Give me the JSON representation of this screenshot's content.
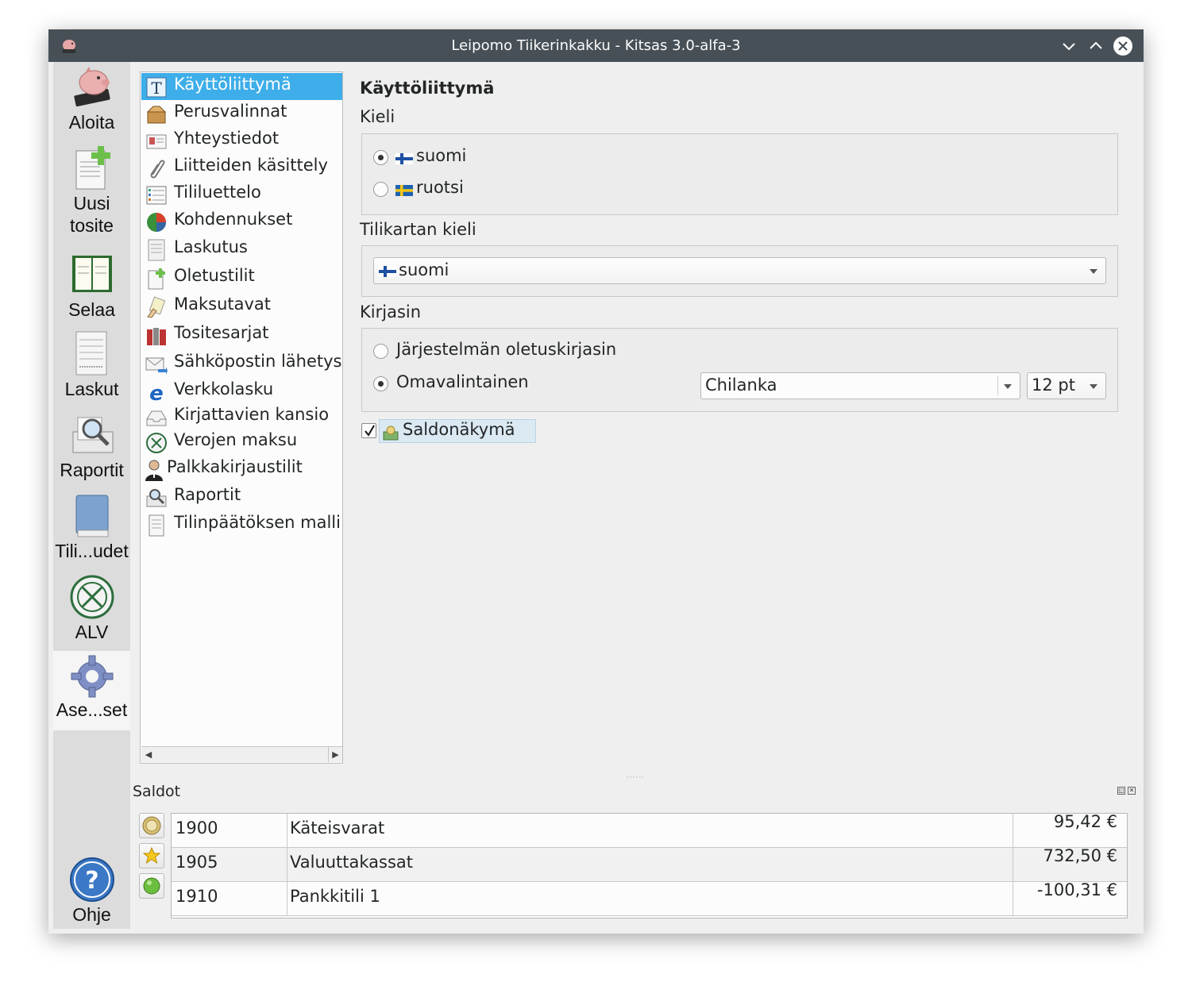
{
  "window": {
    "title": "Leipomo Tiikerinkakku - Kitsas 3.0-alfa-3"
  },
  "leftbar": {
    "items": [
      {
        "label": "Aloita",
        "icon": "piggy-bank-icon"
      },
      {
        "label": "Uusi\ntosite",
        "icon": "new-document-icon"
      },
      {
        "label": "Selaa",
        "icon": "journal-book-icon"
      },
      {
        "label": "Laskut",
        "icon": "invoice-icon"
      },
      {
        "label": "Raportit",
        "icon": "report-magnifier-icon"
      },
      {
        "label": "Tili...udet",
        "icon": "blue-book-icon"
      },
      {
        "label": "ALV",
        "icon": "tax-seal-icon"
      },
      {
        "label": "Ase...set",
        "icon": "gear-icon"
      },
      {
        "label": "Ohje",
        "icon": "help-icon"
      }
    ]
  },
  "nav": {
    "items": [
      {
        "label": "Käyttöliittymä",
        "icon": "text-t-icon",
        "selected": true
      },
      {
        "label": "Perusvalinnat",
        "icon": "open-box-icon"
      },
      {
        "label": "Yhteystiedot",
        "icon": "contact-card-icon"
      },
      {
        "label": "Liitteiden käsittely",
        "icon": "paperclip-icon"
      },
      {
        "label": "Tililuettelo",
        "icon": "account-list-icon"
      },
      {
        "label": "Kohdennukset",
        "icon": "pie-chart-icon"
      },
      {
        "label": "Laskutus",
        "icon": "invoice-icon"
      },
      {
        "label": "Oletustilit",
        "icon": "add-document-icon"
      },
      {
        "label": "Maksutavat",
        "icon": "payment-card-icon"
      },
      {
        "label": "Tositesarjat",
        "icon": "binders-icon"
      },
      {
        "label": "Sähköpostin lähetys",
        "icon": "email-send-icon"
      },
      {
        "label": "Verkkolasku",
        "icon": "e-invoice-icon"
      },
      {
        "label": "Kirjattavien kansio",
        "icon": "inbox-tray-icon"
      },
      {
        "label": "Verojen maksu",
        "icon": "tax-seal-icon"
      },
      {
        "label": "Palkkakirjaustilit",
        "icon": "person-icon"
      },
      {
        "label": "Raportit",
        "icon": "report-magnifier-icon"
      },
      {
        "label": "Tilinpäätöksen malli",
        "icon": "document-icon"
      }
    ]
  },
  "page": {
    "title": "Käyttöliittymä",
    "language": {
      "label": "Kieli",
      "options": [
        {
          "label": "suomi",
          "checked": true,
          "flag": "finland-flag-icon"
        },
        {
          "label": "ruotsi",
          "checked": false,
          "flag": "sweden-flag-icon"
        }
      ]
    },
    "chart_language": {
      "label": "Tilikartan kieli",
      "value": "suomi",
      "flag": "finland-flag-icon"
    },
    "font": {
      "label": "Kirjasin",
      "system_option": "Järjestelmän oletuskirjasin",
      "custom_option": "Omavalintainen",
      "custom_checked": true,
      "family": "Chilanka",
      "size": "12 pt"
    },
    "saldo": {
      "label": "Saldonäkymä",
      "checked": true
    }
  },
  "dock": {
    "title": "Saldot",
    "rows": [
      {
        "account": "1900",
        "name": "Käteisvarat",
        "balance": "95,42 €",
        "icon": "coin-icon"
      },
      {
        "account": "1905",
        "name": "Valuuttakassat",
        "balance": "732,50 €",
        "icon": "star-icon"
      },
      {
        "account": "1910",
        "name": "Pankkitili 1",
        "balance": "-100,31 €",
        "icon": "green-ball-icon"
      }
    ]
  },
  "colors": {
    "titlebar": "#475057",
    "selection": "#3daee9",
    "window_bg": "#efefef"
  }
}
